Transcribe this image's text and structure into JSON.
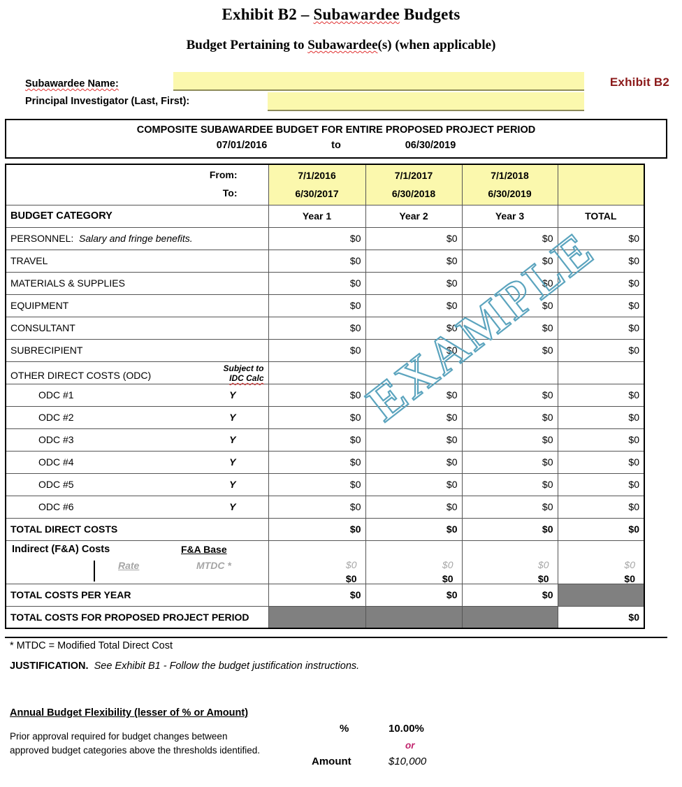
{
  "titles": {
    "main_prefix": "Exhibit B2 – ",
    "main_sq": "Subawardee",
    "main_suffix": " Budgets",
    "sub_prefix": "Budget Pertaining to ",
    "sub_sq": "Subawardee",
    "sub_suffix": "(s) (when applicable)"
  },
  "header_fields": {
    "subawardee_name_label": "Subawardee Name:",
    "subawardee_name_value": "",
    "pi_label": "Principal Investigator (Last, First):",
    "pi_value": "",
    "exhibit_tag": "Exhibit B2",
    "exhibit_tag_color": "#8B1A1A",
    "field_fill_color": "#FBF8AD"
  },
  "composite": {
    "title": "COMPOSITE SUBAWARDEE BUDGET FOR ENTIRE PROPOSED PROJECT PERIOD",
    "start_date": "07/01/2016",
    "to_word": "to",
    "end_date": "06/30/2019"
  },
  "table": {
    "from_label": "From:",
    "to_label": "To:",
    "category_header": "BUDGET CATEGORY",
    "period_from": [
      "7/1/2016",
      "7/1/2017",
      "7/1/2018"
    ],
    "period_to": [
      "6/30/2017",
      "6/30/2018",
      "6/30/2019"
    ],
    "year_headers": [
      "Year 1",
      "Year 2",
      "Year 3"
    ],
    "total_header": "TOTAL",
    "rows": [
      {
        "label": "PERSONNEL:",
        "label_italic": "Salary and fringe benefits.",
        "y1": "$0",
        "y2": "$0",
        "y3": "$0",
        "total": "$0"
      },
      {
        "label": "TRAVEL",
        "y1": "$0",
        "y2": "$0",
        "y3": "$0",
        "total": "$0"
      },
      {
        "label": "MATERIALS & SUPPLIES",
        "y1": "$0",
        "y2": "$0",
        "y3": "$0",
        "total": "$0"
      },
      {
        "label": "EQUIPMENT",
        "y1": "$0",
        "y2": "$0",
        "y3": "$0",
        "total": "$0"
      },
      {
        "label": "CONSULTANT",
        "y1": "$0",
        "y2": "$0",
        "y3": "$0",
        "total": "$0"
      },
      {
        "label": "SUBRECIPIENT",
        "y1": "$0",
        "y2": "$0",
        "y3": "$0",
        "total": "$0"
      }
    ],
    "odc_header": {
      "label": "OTHER DIRECT COSTS (ODC)",
      "sub_line1": "Subject to",
      "sub_line2": "IDC Calc"
    },
    "odc_rows": [
      {
        "label": "ODC #1",
        "flag": "Y",
        "y1": "$0",
        "y2": "$0",
        "y3": "$0",
        "total": "$0"
      },
      {
        "label": "ODC #2",
        "flag": "Y",
        "y1": "$0",
        "y2": "$0",
        "y3": "$0",
        "total": "$0"
      },
      {
        "label": "ODC #3",
        "flag": "Y",
        "y1": "$0",
        "y2": "$0",
        "y3": "$0",
        "total": "$0"
      },
      {
        "label": "ODC #4",
        "flag": "Y",
        "y1": "$0",
        "y2": "$0",
        "y3": "$0",
        "total": "$0"
      },
      {
        "label": "ODC #5",
        "flag": "Y",
        "y1": "$0",
        "y2": "$0",
        "y3": "$0",
        "total": "$0"
      },
      {
        "label": "ODC #6",
        "flag": "Y",
        "y1": "$0",
        "y2": "$0",
        "y3": "$0",
        "total": "$0"
      }
    ],
    "total_direct": {
      "label": "TOTAL DIRECT COSTS",
      "y1": "$0",
      "y2": "$0",
      "y3": "$0",
      "total": "$0"
    },
    "indirect": {
      "label": "Indirect (F&A) Costs",
      "base_label": "F&A Base",
      "rate_label": "Rate",
      "mtdc_label": "MTDC *",
      "faint_y1": "$0",
      "faint_y2": "$0",
      "faint_y3": "$0",
      "faint_total": "$0",
      "y1": "$0",
      "y2": "$0",
      "y3": "$0",
      "total": "$0"
    },
    "total_per_year": {
      "label": "TOTAL COSTS PER YEAR",
      "y1": "$0",
      "y2": "$0",
      "y3": "$0",
      "total": ""
    },
    "total_period": {
      "label": "TOTAL COSTS FOR PROPOSED PROJECT PERIOD",
      "total": "$0"
    },
    "shaded_color": "#808080",
    "header_fill_color": "#FBF8AD"
  },
  "watermark": {
    "text": "EXAMPLE",
    "color": "#5BA4BE"
  },
  "footer": {
    "mtdc_note": "* MTDC = Modified Total Direct Cost",
    "justification_label": "JUSTIFICATION.",
    "justification_text": "See Exhibit B1 - Follow the budget justification instructions.",
    "flex_title": "Annual Budget Flexibility (lesser of % or Amount)",
    "flex_body": "Prior approval required for budget changes between approved budget categories above the thresholds identified.",
    "pct_label": "%",
    "pct_value": "10.00%",
    "or_word": "or",
    "or_color": "#C0226B",
    "amount_label": "Amount",
    "amount_value": "$10,000"
  }
}
